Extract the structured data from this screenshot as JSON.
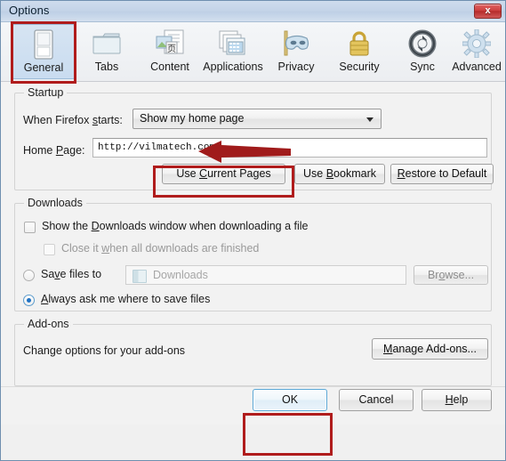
{
  "window": {
    "title": "Options",
    "close_label": "x"
  },
  "tabs": [
    {
      "label": "General",
      "icon": "general-panel-icon",
      "selected": true
    },
    {
      "label": "Tabs",
      "icon": "tabs-folder-icon",
      "selected": false
    },
    {
      "label": "Content",
      "icon": "content-page-icon",
      "selected": false
    },
    {
      "label": "Applications",
      "icon": "applications-windows-icon",
      "selected": false
    },
    {
      "label": "Privacy",
      "icon": "privacy-mask-icon",
      "selected": false
    },
    {
      "label": "Security",
      "icon": "security-padlock-icon",
      "selected": false
    },
    {
      "label": "Sync",
      "icon": "sync-arrows-icon",
      "selected": false
    },
    {
      "label": "Advanced",
      "icon": "advanced-gear-icon",
      "selected": false
    }
  ],
  "startup": {
    "group_title": "Startup",
    "when_firefox_starts_label": "When Firefox starts:",
    "when_firefox_starts_value": "Show my home page",
    "home_page_label": "Home Page:",
    "home_page_value": "http://vilmatech.com",
    "use_current_pages_label": "Use Current Pages",
    "use_bookmark_label": "Use Bookmark",
    "restore_to_default_label": "Restore to Default"
  },
  "downloads": {
    "group_title": "Downloads",
    "show_window_label": "Show the Downloads window when downloading a file",
    "show_window_checked": false,
    "close_when_finished_label": "Close it when all downloads are finished",
    "close_when_finished_checked": false,
    "close_when_finished_disabled": true,
    "save_files_to_label": "Save files to",
    "save_files_to_selected": false,
    "save_files_to_value": "Downloads",
    "browse_label": "Browse...",
    "always_ask_label": "Always ask me where to save files",
    "always_ask_selected": true
  },
  "addons": {
    "group_title": "Add-ons",
    "description": "Change options for your add-ons",
    "manage_label": "Manage Add-ons..."
  },
  "footer": {
    "ok_label": "OK",
    "cancel_label": "Cancel",
    "help_label": "Help"
  },
  "annotations": {
    "color": "#b01c1c",
    "highlight_general_tab": true,
    "highlight_use_current_pages": true,
    "highlight_ok_button": true,
    "arrow_points_to": "home-page-field"
  }
}
